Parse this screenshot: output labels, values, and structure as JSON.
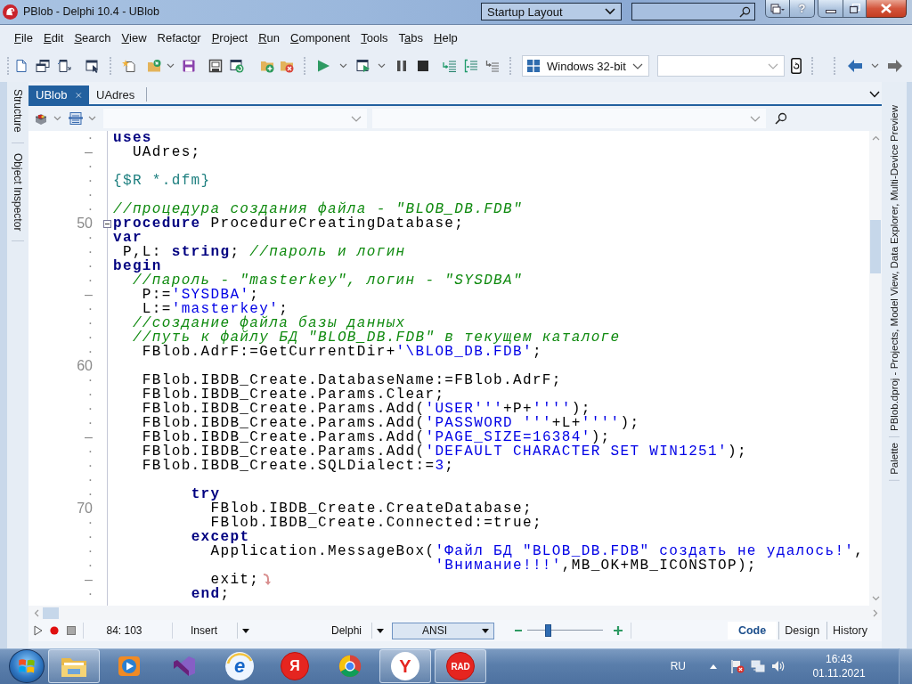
{
  "window": {
    "title": "PBlob - Delphi 10.4 - UBlob",
    "layout": "Startup Layout",
    "help_button": "?"
  },
  "menu": [
    {
      "key": "F",
      "after": "ile"
    },
    {
      "key": "E",
      "after": "dit"
    },
    {
      "key": "S",
      "after": "earch"
    },
    {
      "key": "V",
      "after": "iew"
    },
    {
      "before": "Refact",
      "key": "o",
      "after": "r"
    },
    {
      "key": "P",
      "after": "roject"
    },
    {
      "key": "R",
      "after": "un"
    },
    {
      "key": "C",
      "after": "omponent"
    },
    {
      "key": "T",
      "after": "ools"
    },
    {
      "before": "T",
      "key": "a",
      "after": "bs"
    },
    {
      "key": "H",
      "after": "elp"
    }
  ],
  "toolbar": {
    "platform": "Windows 32-bit"
  },
  "side_tabs_left": [
    {
      "label": "Structure"
    },
    {
      "label": "Object Inspector"
    }
  ],
  "side_tabs_right": [
    {
      "label": "PBlob.dproj - Projects, Model View, Data Explorer, Multi-Device Preview"
    },
    {
      "label": "Palette"
    }
  ],
  "editor_tabs": [
    {
      "label": "UBlob",
      "selected": true
    },
    {
      "label": "UAdres",
      "selected": false
    }
  ],
  "code": [
    {
      "gutter": "·",
      "tokens": [
        {
          "kind": "keyword",
          "text": "uses"
        }
      ]
    },
    {
      "gutter": "–",
      "tokens": [
        {
          "kind": "plain",
          "text": "  UAdres;"
        }
      ]
    },
    {
      "gutter": "·"
    },
    {
      "gutter": "·",
      "tokens": [
        {
          "kind": "directive",
          "text": "{$R *.dfm}"
        }
      ]
    },
    {
      "gutter": "·"
    },
    {
      "gutter": "·",
      "tokens": [
        {
          "kind": "comment",
          "text": "//процедура создания файла - \"BLOB_DB.FDB\""
        }
      ]
    },
    {
      "gutter": "50",
      "fold": {
        "expanded": true
      },
      "tokens": [
        {
          "kind": "keyword",
          "text": "procedure"
        },
        {
          "kind": "plain",
          "text": " ProcedureCreatingDatabase;"
        }
      ]
    },
    {
      "gutter": "·",
      "tokens": [
        {
          "kind": "keyword",
          "text": "var"
        }
      ]
    },
    {
      "gutter": "·",
      "tokens": [
        {
          "kind": "plain",
          "text": " P,L: "
        },
        {
          "kind": "keyword",
          "text": "string"
        },
        {
          "kind": "plain",
          "text": "; "
        },
        {
          "kind": "comment",
          "text": "//пароль и логин"
        }
      ]
    },
    {
      "gutter": "·",
      "tokens": [
        {
          "kind": "keyword",
          "text": "begin"
        }
      ]
    },
    {
      "gutter": "·",
      "tokens": [
        {
          "kind": "comment",
          "text": "  //пароль - \"masterkey\", логин - \"SYSDBA\""
        }
      ]
    },
    {
      "gutter": "–",
      "tokens": [
        {
          "kind": "plain",
          "text": "   P:="
        },
        {
          "kind": "string",
          "text": "'SYSDBA'"
        },
        {
          "kind": "plain",
          "text": ";"
        }
      ]
    },
    {
      "gutter": "·",
      "tokens": [
        {
          "kind": "plain",
          "text": "   L:="
        },
        {
          "kind": "string",
          "text": "'masterkey'"
        },
        {
          "kind": "plain",
          "text": ";"
        }
      ]
    },
    {
      "gutter": "·",
      "tokens": [
        {
          "kind": "comment",
          "text": "  //создание файла базы данных"
        }
      ]
    },
    {
      "gutter": "·",
      "tokens": [
        {
          "kind": "comment",
          "text": "  //путь к файлу БД \"BLOB_DB.FDB\" в текущем каталоге"
        }
      ]
    },
    {
      "gutter": "·",
      "tokens": [
        {
          "kind": "plain",
          "text": "   FBlob.AdrF:=GetCurrentDir+"
        },
        {
          "kind": "string",
          "text": "'\\BLOB_DB.FDB'"
        },
        {
          "kind": "plain",
          "text": ";"
        }
      ]
    },
    {
      "gutter": "60"
    },
    {
      "gutter": "·",
      "tokens": [
        {
          "kind": "plain",
          "text": "   FBlob.IBDB_Create.DatabaseName:=FBlob.AdrF;"
        }
      ]
    },
    {
      "gutter": "·",
      "tokens": [
        {
          "kind": "plain",
          "text": "   FBlob.IBDB_Create.Params.Clear;"
        }
      ]
    },
    {
      "gutter": "·",
      "tokens": [
        {
          "kind": "plain",
          "text": "   FBlob.IBDB_Create.Params.Add("
        },
        {
          "kind": "string",
          "text": "'USER'''"
        },
        {
          "kind": "plain",
          "text": "+P+"
        },
        {
          "kind": "string",
          "text": "''''"
        },
        {
          "kind": "plain",
          "text": ");"
        }
      ]
    },
    {
      "gutter": "·",
      "tokens": [
        {
          "kind": "plain",
          "text": "   FBlob.IBDB_Create.Params.Add("
        },
        {
          "kind": "string",
          "text": "'PASSWORD '''"
        },
        {
          "kind": "plain",
          "text": "+L+"
        },
        {
          "kind": "string",
          "text": "''''"
        },
        {
          "kind": "plain",
          "text": ");"
        }
      ]
    },
    {
      "gutter": "–",
      "tokens": [
        {
          "kind": "plain",
          "text": "   FBlob.IBDB_Create.Params.Add("
        },
        {
          "kind": "string",
          "text": "'PAGE_SIZE=16384'"
        },
        {
          "kind": "plain",
          "text": ");"
        }
      ]
    },
    {
      "gutter": "·",
      "tokens": [
        {
          "kind": "plain",
          "text": "   FBlob.IBDB_Create.Params.Add("
        },
        {
          "kind": "string",
          "text": "'DEFAULT CHARACTER SET WIN1251'"
        },
        {
          "kind": "plain",
          "text": ");"
        }
      ]
    },
    {
      "gutter": "·",
      "tokens": [
        {
          "kind": "plain",
          "text": "   FBlob.IBDB_Create.SQLDialect:="
        },
        {
          "kind": "number",
          "text": "3"
        },
        {
          "kind": "plain",
          "text": ";"
        }
      ]
    },
    {
      "gutter": "·"
    },
    {
      "gutter": "·",
      "tokens": [
        {
          "kind": "keyword",
          "text": "        try"
        }
      ]
    },
    {
      "gutter": "70",
      "tokens": [
        {
          "kind": "plain",
          "text": "          FBlob.IBDB_Create.CreateDatabase;"
        }
      ]
    },
    {
      "gutter": "·",
      "tokens": [
        {
          "kind": "plain",
          "text": "          FBlob.IBDB_Create.Connected:=true;"
        }
      ]
    },
    {
      "gutter": "·",
      "tokens": [
        {
          "kind": "keyword",
          "text": "        except"
        }
      ]
    },
    {
      "gutter": "·",
      "tokens": [
        {
          "kind": "plain",
          "text": "          Application.MessageBox("
        },
        {
          "kind": "string",
          "text": "'Файл БД \"BLOB_DB.FDB\" создать не удалось!'"
        },
        {
          "kind": "plain",
          "text": ","
        }
      ]
    },
    {
      "gutter": "·",
      "tokens": [
        {
          "kind": "string",
          "text": "                                 'Внимание!!!'"
        },
        {
          "kind": "plain",
          "text": ",MB_OK+MB_ICONSTOP);"
        }
      ]
    },
    {
      "gutter": "–",
      "mark": {
        "kind": "jump"
      },
      "tokens": [
        {
          "kind": "plain",
          "text": "          exit;"
        }
      ]
    },
    {
      "gutter": "·",
      "tokens": [
        {
          "kind": "keyword",
          "text": "        end"
        },
        {
          "kind": "plain",
          "text": ";"
        }
      ]
    }
  ],
  "status_bar": {
    "position": "84: 103",
    "mode": "Insert",
    "language": "Delphi",
    "encoding": "ANSI",
    "zoom": {
      "level": 0.25
    },
    "views": [
      {
        "label": "Code",
        "selected": true
      },
      {
        "label": "Design",
        "selected": false
      },
      {
        "label": "History",
        "selected": false
      }
    ]
  },
  "taskbar": {
    "apps": [
      {
        "kind": "folder",
        "running": true
      },
      {
        "kind": "player",
        "running": false
      },
      {
        "kind": "ribbon",
        "running": false
      },
      {
        "kind": "orbit",
        "glyph": "e",
        "running": false
      },
      {
        "kind": "disc",
        "glyph": "Я",
        "running": false
      },
      {
        "kind": "wheel",
        "running": false
      },
      {
        "kind": "badge",
        "glyph": "Y",
        "running": true
      },
      {
        "kind": "disc",
        "glyph": "RAD",
        "running": true
      }
    ],
    "language": "RU",
    "time": "16:43",
    "date": "01.11.2021"
  }
}
